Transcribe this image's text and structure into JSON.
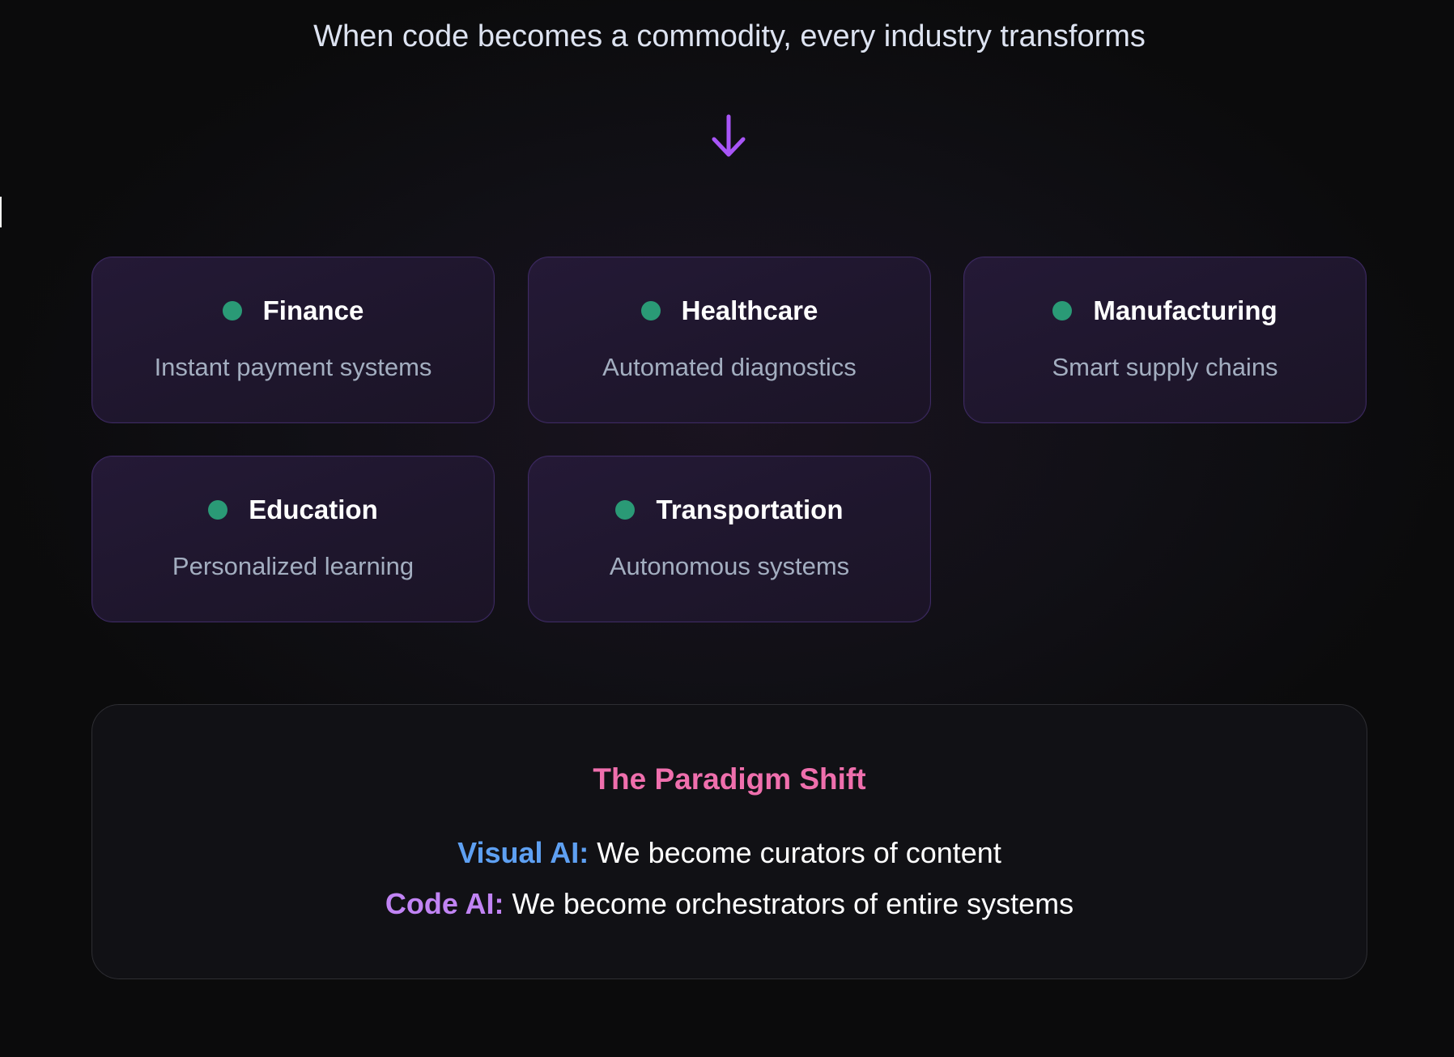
{
  "headline": "When code becomes a commodity, every industry transforms",
  "arrow_icon": "arrow-down-icon",
  "colors": {
    "arrow": "#a855f7",
    "dot": "#2a9a76",
    "shift_title": "#ef6fad",
    "visual_label": "#5ea0f2",
    "code_label": "#c184f4",
    "description": "#a3aec0"
  },
  "industries": [
    {
      "title": "Finance",
      "description": "Instant payment systems"
    },
    {
      "title": "Healthcare",
      "description": "Automated diagnostics"
    },
    {
      "title": "Manufacturing",
      "description": "Smart supply chains"
    },
    {
      "title": "Education",
      "description": "Personalized learning"
    },
    {
      "title": "Transportation",
      "description": "Autonomous systems"
    }
  ],
  "paradigm_shift": {
    "title": "The Paradigm Shift",
    "visual": {
      "label": "Visual AI:",
      "text": "We become curators of content"
    },
    "code": {
      "label": "Code AI:",
      "text": "We become orchestrators of entire systems"
    }
  }
}
